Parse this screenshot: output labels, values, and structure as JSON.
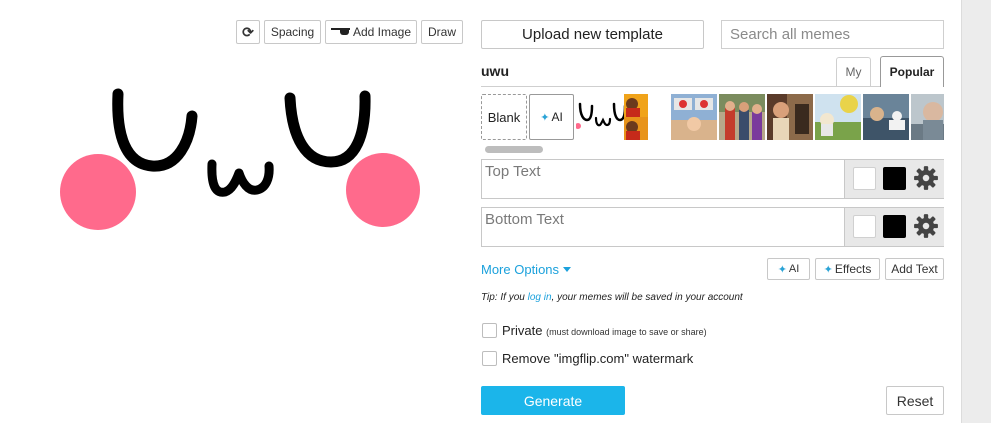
{
  "toolbar": {
    "rotate_glyph": "⟳",
    "spacing_label": "Spacing",
    "add_image_label": "Add Image",
    "draw_label": "Draw"
  },
  "upload_label": "Upload new template",
  "search": {
    "placeholder": "Search all memes"
  },
  "meme_title": "uwu",
  "tabs": {
    "my": "My",
    "popular": "Popular"
  },
  "templates": {
    "blank_label": "Blank",
    "ai_label": "AI",
    "thumbnails": [
      "uwu-face",
      "drake",
      "two-buttons",
      "distracted",
      "disaster-girl",
      "stonks",
      "woman-yelling-cat",
      "gru-plan",
      "sad-man"
    ]
  },
  "text_boxes": [
    {
      "placeholder": "Top Text",
      "outline_color": "#ffffff",
      "fill_color": "#000000"
    },
    {
      "placeholder": "Bottom Text",
      "outline_color": "#ffffff",
      "fill_color": "#000000"
    }
  ],
  "more_options_label": "More Options",
  "ai_label": "AI",
  "effects_label": "Effects",
  "add_text_label": "Add Text",
  "tip": {
    "prefix": "Tip: If you ",
    "link": "log in",
    "suffix": ", your memes will be saved in your account"
  },
  "private": {
    "label": "Private",
    "note": "(must download image to save or share)"
  },
  "watermark_label": "Remove \"imgflip.com\" watermark",
  "generate_label": "Generate",
  "reset_label": "Reset",
  "colors": {
    "accent": "#1bb5ea",
    "link": "#1ba1dc",
    "blush": "#ff6a8c"
  },
  "icons": {
    "rotate": "rotate-icon",
    "add_image": "glasses-icon",
    "sparkle": "sparkle-icon",
    "gear": "gear-icon",
    "caret": "caret-down-icon"
  }
}
